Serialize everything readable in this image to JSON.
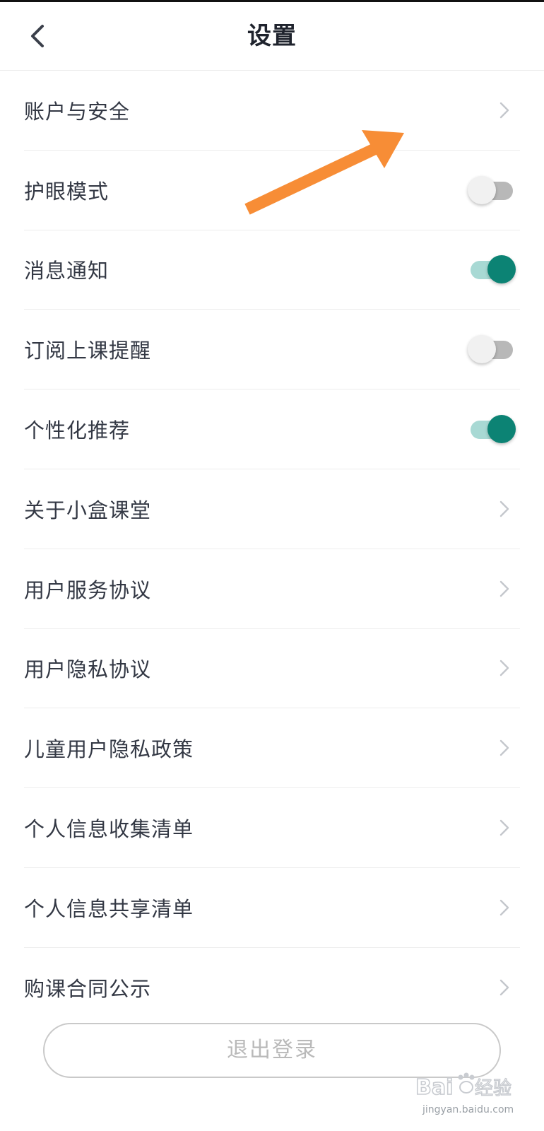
{
  "header": {
    "title": "设置",
    "back_icon": "chevron-left-icon"
  },
  "settings": [
    {
      "label": "账户与安全",
      "control": "chevron"
    },
    {
      "label": "护眼模式",
      "control": "toggle",
      "on": false
    },
    {
      "label": "消息通知",
      "control": "toggle",
      "on": true
    },
    {
      "label": "订阅上课提醒",
      "control": "toggle",
      "on": false
    },
    {
      "label": "个性化推荐",
      "control": "toggle",
      "on": true
    },
    {
      "label": "关于小盒课堂",
      "control": "chevron"
    },
    {
      "label": "用户服务协议",
      "control": "chevron"
    },
    {
      "label": "用户隐私协议",
      "control": "chevron"
    },
    {
      "label": "儿童用户隐私政策",
      "control": "chevron"
    },
    {
      "label": "个人信息收集清单",
      "control": "chevron"
    },
    {
      "label": "个人信息共享清单",
      "control": "chevron"
    },
    {
      "label": "购课合同公示",
      "control": "chevron"
    }
  ],
  "logout": {
    "label": "退出登录"
  },
  "watermark": {
    "logo_text": "Baidu经验",
    "sub_text": "jingyan.baidu.com"
  },
  "colors": {
    "accent": "#0c8374",
    "toggle_on_track": "#a8d9d4",
    "toggle_off_track": "#b8b8b8",
    "annotation_arrow": "#f78d36",
    "logout_text": "#b9b9b9"
  }
}
